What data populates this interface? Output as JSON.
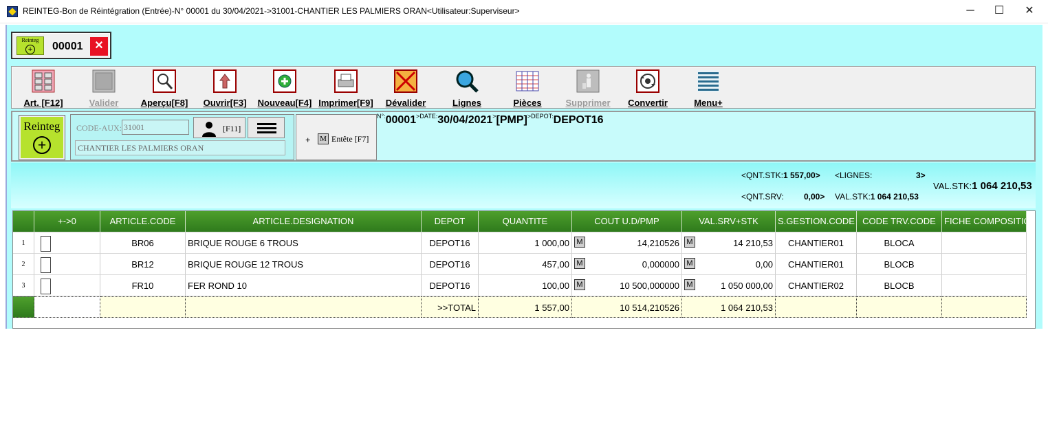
{
  "window": {
    "title": "REINTEG-Bon de Réintégration (Entrée)-N° 00001 du 30/04/2021->31001-CHANTIER LES PALMIERS ORAN<Utilisateur:Superviseur>",
    "minimize": "─",
    "maximize": "☐",
    "close": "✕"
  },
  "doc_tab": {
    "icon_text": "Reinteg",
    "icon_plus": "+",
    "number": "00001",
    "close": "✕"
  },
  "toolbar": [
    {
      "label": "Art. [F12]",
      "icon": "articles-icon",
      "enabled": true
    },
    {
      "label": "Valider",
      "icon": "validate-icon",
      "enabled": false
    },
    {
      "label": "Aperçu[F8]",
      "icon": "preview-icon",
      "enabled": true
    },
    {
      "label": "Ouvrir[F3]",
      "icon": "open-icon",
      "enabled": true
    },
    {
      "label": "Nouveau[F4]",
      "icon": "new-icon",
      "enabled": true
    },
    {
      "label": "Imprimer[F9]",
      "icon": "print-icon",
      "enabled": true
    },
    {
      "label": "Dévalider",
      "icon": "invalidate-icon",
      "enabled": true
    },
    {
      "label": "Lignes",
      "icon": "lines-search-icon",
      "enabled": true
    },
    {
      "label": "Pièces",
      "icon": "documents-icon",
      "enabled": true
    },
    {
      "label": "Supprimer",
      "icon": "delete-icon",
      "enabled": false
    },
    {
      "label": "Convertir",
      "icon": "convert-icon",
      "enabled": true
    },
    {
      "label": "Menu+",
      "icon": "menu-lines-icon",
      "enabled": true
    }
  ],
  "header": {
    "reinteg_label": "Reinteg",
    "reinteg_plus": "+",
    "code_aux_label": "CODE-AUX:",
    "code_aux_value": "31001",
    "aux_name": "CHANTIER LES PALMIERS ORAN",
    "f11_label": "[F11]",
    "entete_plus": "+",
    "entete_m": "M",
    "entete_label": "Entête [F7]",
    "doc": {
      "num_key": "N°:",
      "num": "00001",
      "date_key": ">DATE:",
      "date": "30/04/2021",
      "pmp_key": ">",
      "pmp": "[PMP]",
      "depot_key": ">DEPOT:",
      "depot": "DEPOT16"
    }
  },
  "totals": {
    "qnt_stk_label": "<QNT.STK:",
    "qnt_stk": "1 557,00>",
    "lignes_label": "<LIGNES:",
    "lignes": "3>",
    "qnt_srv_label": "<QNT.SRV:",
    "qnt_srv": "0,00>",
    "val_stk_small_label": "VAL.STK:",
    "val_stk_small": "1 064 210,53",
    "val_stk_big_label": "VAL.STK:",
    "val_stk_big": "1 064 210,53"
  },
  "grid": {
    "columns": [
      "",
      "+->0",
      "ARTICLE.CODE",
      "ARTICLE.DESIGNATION",
      "DEPOT",
      "QUANTITE",
      "COUT U.D/PMP",
      "VAL.SRV+STK",
      "S.GESTION.CODE",
      "CODE TRV.CODE",
      "FICHE COMPOSITIO"
    ],
    "rows": [
      {
        "n": "1",
        "code": "BR06",
        "designation": "BRIQUE ROUGE 6 TROUS",
        "depot": "DEPOT16",
        "quantite": "1 000,00",
        "cout": "14,210526",
        "val": "14 210,53",
        "sgestion": "CHANTIER01",
        "trv": "BLOCA",
        "fiche": ""
      },
      {
        "n": "2",
        "code": "BR12",
        "designation": "BRIQUE ROUGE 12 TROUS",
        "depot": "DEPOT16",
        "quantite": "457,00",
        "cout": "0,000000",
        "val": "0,00",
        "sgestion": "CHANTIER01",
        "trv": "BLOCB",
        "fiche": ""
      },
      {
        "n": "3",
        "code": "FR10",
        "designation": "FER ROND 10",
        "depot": "DEPOT16",
        "quantite": "100,00",
        "cout": "10 500,000000",
        "val": "1 050 000,00",
        "sgestion": "CHANTIER02",
        "trv": "BLOCB",
        "fiche": ""
      }
    ],
    "m_marker": "M",
    "total": {
      "label": ">>TOTAL",
      "quantite": "1 557,00",
      "cout": "10 514,210526",
      "val": "1 064 210,53"
    }
  }
}
